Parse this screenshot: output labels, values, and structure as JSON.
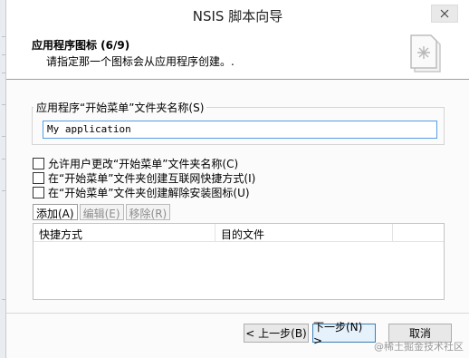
{
  "window": {
    "title": "NSIS 脚本向导"
  },
  "header": {
    "title": "应用程序图标 (6/9)",
    "description": "请指定那一个图标会从应用程序创建。."
  },
  "folder_group": {
    "label": "应用程序“开始菜单”文件夹名称(S)",
    "value": "My application"
  },
  "checkboxes": [
    {
      "label": "允许用户更改“开始菜单”文件夹名称(C)",
      "checked": false
    },
    {
      "label": "在“开始菜单”文件夹创建互联网快捷方式(I)",
      "checked": false
    },
    {
      "label": "在“开始菜单”文件夹创建解除安装图标(U)",
      "checked": false
    }
  ],
  "list_buttons": {
    "add": "添加(A)",
    "edit": "编辑(E)",
    "remove": "移除(R)"
  },
  "list": {
    "columns": [
      "快捷方式",
      "目的文件"
    ]
  },
  "footer": {
    "back": "< 上一步(B)",
    "next": "下一步(N) >",
    "cancel": "取消"
  },
  "watermark": "@稀土掘金技术社区"
}
